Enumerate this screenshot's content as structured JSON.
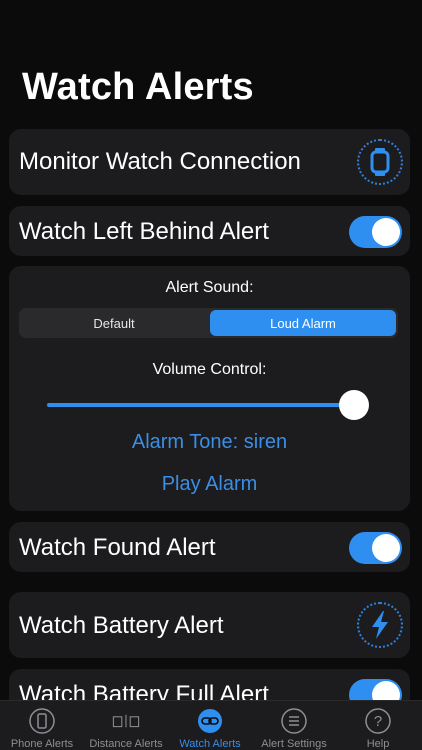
{
  "header": {
    "title": "Watch Alerts"
  },
  "rows": {
    "monitor": {
      "label": "Monitor Watch Connection",
      "icon": "watch-icon"
    },
    "left_behind": {
      "label": "Watch Left Behind Alert",
      "toggle_on": true
    },
    "found": {
      "label": "Watch Found Alert",
      "toggle_on": true
    },
    "battery": {
      "label": "Watch Battery Alert",
      "icon": "lightning-icon"
    },
    "battery_full": {
      "label": "Watch Battery Full Alert",
      "toggle_on": true
    }
  },
  "sound_panel": {
    "alert_sound_label": "Alert Sound:",
    "options": [
      "Default",
      "Loud Alarm"
    ],
    "selected": "Loud Alarm",
    "volume_label": "Volume Control:",
    "volume_level": 0.94,
    "tone_link": "Alarm Tone: siren",
    "play_link": "Play Alarm"
  },
  "tabbar": {
    "tabs": [
      {
        "label": "Phone Alerts",
        "icon": "phone-icon"
      },
      {
        "label": "Distance Alerts",
        "icon": "distance-icon"
      },
      {
        "label": "Watch Alerts",
        "icon": "watch-link-icon"
      },
      {
        "label": "Alert Settings",
        "icon": "list-icon"
      },
      {
        "label": "Help",
        "icon": "help-icon"
      }
    ],
    "active_index": 2
  },
  "colors": {
    "accent": "#2f8ff0",
    "link": "#3a8ee6",
    "card": "#1c1c1e",
    "background": "#0b0b0b"
  }
}
